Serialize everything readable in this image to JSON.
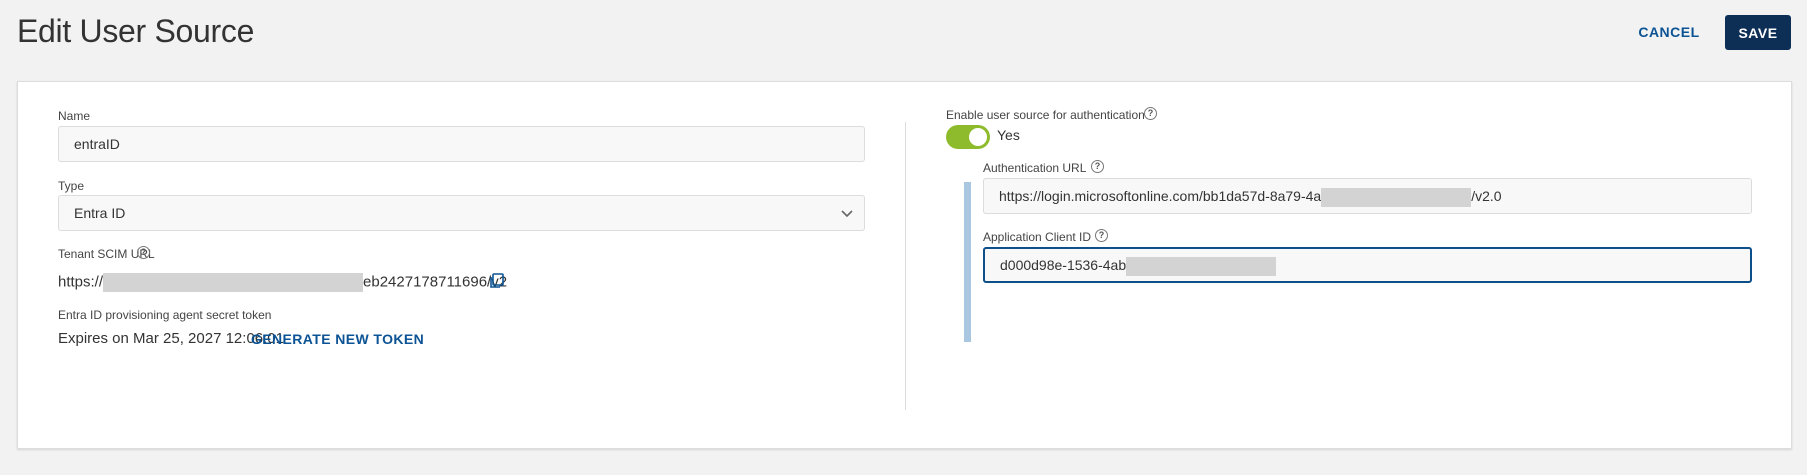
{
  "header": {
    "title": "Edit User Source",
    "cancel_label": "CANCEL",
    "save_label": "SAVE"
  },
  "left": {
    "name_label": "Name",
    "name_value": "entraID",
    "type_label": "Type",
    "type_value": "Entra ID",
    "scim_label": "Tenant SCIM URL",
    "scim_prefix": "https://",
    "scim_suffix": "eb2427178711696/v2",
    "token_label": "Entra ID provisioning agent secret token",
    "token_expiry": "Expires on Mar 25, 2027 12:06:01",
    "generate_label": "GENERATE NEW TOKEN"
  },
  "right": {
    "enable_label": "Enable user source for authentication",
    "enable_state": "Yes",
    "auth_url_label": "Authentication URL",
    "auth_url_prefix": "https://login.microsoftonline.com/bb1da57d-8a79-4a",
    "auth_url_suffix": "/v2.0",
    "client_id_label": "Application Client ID",
    "client_id_prefix": "d000d98e-1536-4ab"
  },
  "icons": {
    "help": "question-circle-icon",
    "copy": "copy-icon",
    "chevron": "chevron-down-icon"
  },
  "colors": {
    "accent": "#0b5394",
    "save_bg": "#0d2f56",
    "toggle_on": "#8dbb2b",
    "focus_border": "#0d4f8a"
  }
}
